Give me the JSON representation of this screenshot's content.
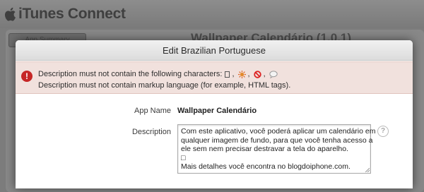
{
  "app": {
    "name": "iTunes Connect",
    "back_button_label": "App Summary",
    "background_title": "Wallpaper Calendário (1.0.1)"
  },
  "modal": {
    "title": "Edit Brazilian Portuguese",
    "errors": {
      "line1_prefix": "Description must not contain the following characters:",
      "line2": "Description must not contain markup language (for example, HTML tags)."
    },
    "fields": {
      "app_name_label": "App Name",
      "app_name_value": "Wallpaper Calendário",
      "description_label": "Description",
      "description_lines": [
        "Com este aplicativo, você poderá aplicar um calendário em",
        "qualquer imagem de fundo, para que você tenha acesso a",
        "ele sem nem precisar destravar a tela do aparelho.",
        "□",
        "Mais detalhes você encontra no blogdoiphone.com."
      ]
    },
    "help_icon_glyph": "?"
  },
  "colors": {
    "error_background": "#f1e1dd",
    "error_icon": "#c62727",
    "modal_header": "#e6e6e6",
    "page_background": "#7c7c7c"
  },
  "icons": [
    "apple-logo-icon",
    "error-icon",
    "help-icon",
    "box-char-icon",
    "sparkle-char-icon",
    "prohibited-char-icon",
    "speech-bubble-char-icon"
  ]
}
